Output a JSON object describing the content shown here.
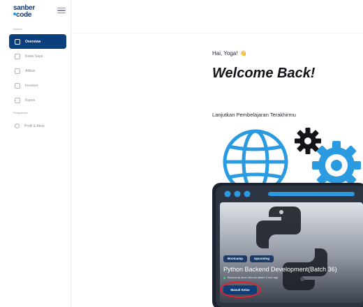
{
  "brand": {
    "line1": "sanber",
    "line2": "code"
  },
  "sidebar": {
    "section_main": "Dasbor",
    "section_settings": "Pengaturan",
    "items": [
      {
        "label": "Overview",
        "icon": "dashboard-icon",
        "active": true
      },
      {
        "label": "Kelas Saya",
        "icon": "class-icon",
        "active": false
      },
      {
        "label": "Afiliasi",
        "icon": "affiliate-icon",
        "active": false
      },
      {
        "label": "Invoices",
        "icon": "invoice-icon",
        "active": false
      },
      {
        "label": "Kupon",
        "icon": "coupon-icon",
        "active": false
      },
      {
        "label": "Profil & Akun",
        "icon": "user-icon",
        "active": false
      }
    ]
  },
  "main": {
    "greeting": "Hai, Yoga!",
    "greeting_emoji": "👋",
    "welcome": "Welcome Back!",
    "continue_label": "Lanjutkan Pembelajaran Terakhirmu",
    "course": {
      "badges": [
        "Bootcamp",
        "Upcoming"
      ],
      "title": "Python Backend Development(Batch 36)",
      "note": "Bootcamp akan dimulai dalam 3 hari lagi",
      "cta": "Masuk Kelas"
    }
  },
  "colors": {
    "primary": "#0b3f7e",
    "accent": "#1aa1e8",
    "highlight": "#e5202e"
  }
}
